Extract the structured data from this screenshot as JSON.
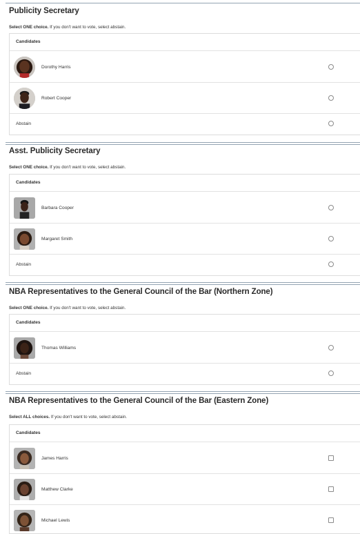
{
  "sections": [
    {
      "title": "Publicity Secretary",
      "instruction_bold": "Select ONE choice.",
      "instruction_rest": " If you don't want to vote, select abstain.",
      "candidates_header": "Candidates",
      "candidates": [
        {
          "name": "Dorothy Harris",
          "control": "radio"
        },
        {
          "name": "Robert Cooper",
          "control": "radio"
        }
      ],
      "abstain": "Abstain"
    },
    {
      "title": "Asst. Publicity Secretary",
      "instruction_bold": "Select ONE choice.",
      "instruction_rest": " If you don't want to vote, select abstain.",
      "candidates_header": "Candidates",
      "candidates": [
        {
          "name": "Barbara Cooper",
          "control": "radio"
        },
        {
          "name": "Margaret Smith",
          "control": "radio"
        }
      ],
      "abstain": "Abstain"
    },
    {
      "title": "NBA Representatives to the General Council of the Bar (Northern Zone)",
      "instruction_bold": "Select ONE choice.",
      "instruction_rest": " If you don't want to vote, select abstain.",
      "candidates_header": "Candidates",
      "candidates": [
        {
          "name": "Thomas Williams",
          "control": "radio"
        }
      ],
      "abstain": "Abstain"
    },
    {
      "title": "NBA Representatives to the General Council of the Bar (Eastern Zone)",
      "instruction_bold": "Select ALL choices.",
      "instruction_rest": " If you don't want to vote, select abstain.",
      "candidates_header": "Candidates",
      "candidates": [
        {
          "name": "James Harris",
          "control": "checkbox"
        },
        {
          "name": "Matthew Clarke",
          "control": "checkbox"
        },
        {
          "name": "Michael Lewis",
          "control": "checkbox"
        }
      ]
    }
  ],
  "colors": {
    "divider": "#93a3b2",
    "border": "#dcdcdc",
    "text": "#333333"
  }
}
